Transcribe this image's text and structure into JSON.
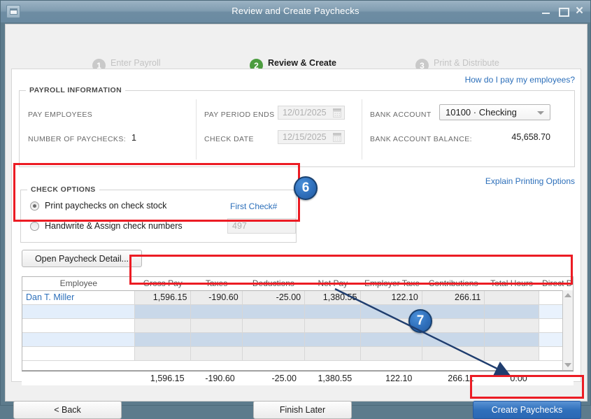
{
  "window": {
    "title": "Review and Create Paychecks",
    "sysmenu_icon": "window-menu-icon",
    "minimize_icon": "minimize-icon",
    "maximize_icon": "maximize-icon",
    "close_icon": "close-icon"
  },
  "steps": [
    {
      "num": "1",
      "label": "Enter Payroll Information",
      "state": "inactive"
    },
    {
      "num": "2",
      "label": "Review & Create Paychecks",
      "state": "active"
    },
    {
      "num": "3",
      "label": "Print & Distribute Paychecks",
      "state": "inactive"
    }
  ],
  "links": {
    "help_employees": "How do I pay my employees?",
    "explain_printing": "Explain Printing Options"
  },
  "payroll_information": {
    "legend": "PAYROLL INFORMATION",
    "pay_employees_label": "PAY EMPLOYEES",
    "pay_employees_value": "",
    "number_of_paychecks_label": "NUMBER OF PAYCHECKS:",
    "number_of_paychecks_value": "1",
    "pay_period_ends_label": "PAY PERIOD ENDS",
    "pay_period_ends_value": "12/01/2025",
    "check_date_label": "CHECK DATE",
    "check_date_value": "12/15/2025",
    "bank_account_label": "BANK ACCOUNT",
    "bank_account_value": "10100 · Checking",
    "bank_balance_label": "BANK ACCOUNT BALANCE:",
    "bank_balance_value": "45,658.70"
  },
  "check_options": {
    "legend": "CHECK OPTIONS",
    "option_print": "Print paychecks on check stock",
    "option_handwrite": "Handwrite & Assign check numbers",
    "selected": "print",
    "first_check_label": "First Check#",
    "first_check_value": "497"
  },
  "buttons": {
    "open_detail": "Open Paycheck Detail...",
    "back": "< Back",
    "finish_later": "Finish Later",
    "create_paychecks": "Create Paychecks"
  },
  "table": {
    "columns": [
      "Employee",
      "Gross Pay",
      "Taxes",
      "Deductions",
      "Net Pay",
      "Employer Taxe",
      "Contributions",
      "Total Hours",
      "Direct Dep"
    ],
    "rows": [
      {
        "employee": "Dan T. Miller",
        "gross_pay": "1,596.15",
        "taxes": "-190.60",
        "deductions": "-25.00",
        "net_pay": "1,380.55",
        "employer_taxes": "122.10",
        "contributions": "266.11",
        "total_hours": "",
        "direct_deposit": ""
      },
      {
        "employee": "",
        "gross_pay": "",
        "taxes": "",
        "deductions": "",
        "net_pay": "",
        "employer_taxes": "",
        "contributions": "",
        "total_hours": "",
        "direct_deposit": ""
      },
      {
        "employee": "",
        "gross_pay": "",
        "taxes": "",
        "deductions": "",
        "net_pay": "",
        "employer_taxes": "",
        "contributions": "",
        "total_hours": "",
        "direct_deposit": ""
      },
      {
        "employee": "",
        "gross_pay": "",
        "taxes": "",
        "deductions": "",
        "net_pay": "",
        "employer_taxes": "",
        "contributions": "",
        "total_hours": "",
        "direct_deposit": ""
      },
      {
        "employee": "",
        "gross_pay": "",
        "taxes": "",
        "deductions": "",
        "net_pay": "",
        "employer_taxes": "",
        "contributions": "",
        "total_hours": "",
        "direct_deposit": ""
      }
    ],
    "totals": {
      "employee": "",
      "gross_pay": "1,596.15",
      "taxes": "-190.60",
      "deductions": "-25.00",
      "net_pay": "1,380.55",
      "employer_taxes": "122.10",
      "contributions": "266.11",
      "total_hours": "0:00",
      "direct_deposit": ""
    },
    "scroll_up_icon": "scroll-up-arrow-icon",
    "scroll_down_icon": "scroll-down-arrow-icon"
  },
  "annotations": {
    "badge_6": "6",
    "badge_7": "7",
    "highlight_color": "#ec1c24",
    "badge_color": "#2f6fbb",
    "arrow_color": "#1f3d6e"
  },
  "colors": {
    "titlebar": "#7f9cb0",
    "accent_link": "#2c6fba",
    "step_active": "#4c9c3f",
    "primary_button": "#2f6fbb"
  }
}
